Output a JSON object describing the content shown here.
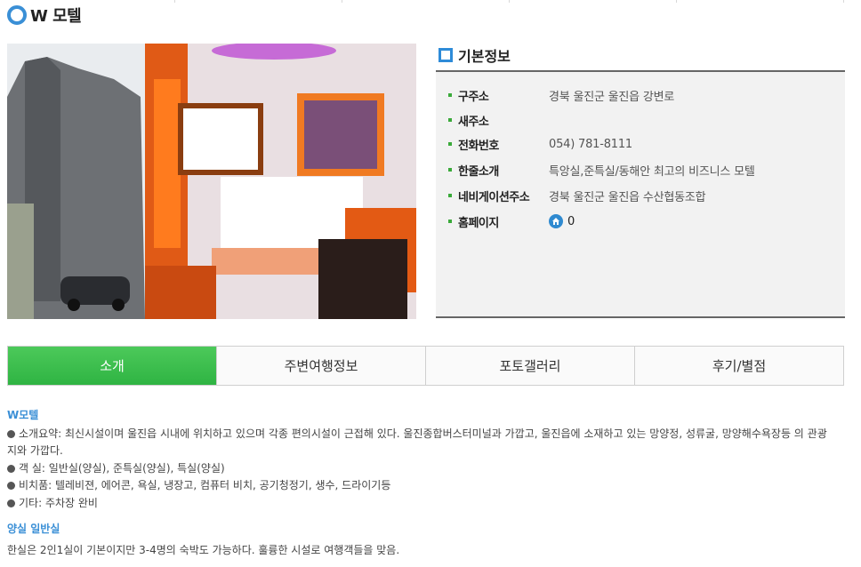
{
  "header": {
    "title": "W 모텔"
  },
  "info": {
    "heading": "기본정보",
    "rows": [
      {
        "label": "구주소",
        "value": "경북 울진군 울진읍 강변로"
      },
      {
        "label": "새주소",
        "value": ""
      },
      {
        "label": "전화번호",
        "value": "054) 781-8111"
      },
      {
        "label": "한줄소개",
        "value": "특앙실,준특실/동해안 최고의 비즈니스 모텔"
      },
      {
        "label": "네비게이션주소",
        "value": "경북 울진군 울진읍 수산협동조합"
      },
      {
        "label": "홈페이지",
        "value": "0"
      }
    ]
  },
  "tabs": [
    "소개",
    "주변여행정보",
    "포토갤러리",
    "후기/별점"
  ],
  "tabs_active": "소개",
  "content": {
    "section1_title": "W모텔",
    "section1_lines": [
      "소개요약: 최신시설이며 울진읍 시내에 위치하고 있으며 각종 편의시설이 근접해 있다. 울진종합버스터미널과 가깝고, 울진읍에 소재하고 있는 망양정, 성류굴, 망양해수욕장등 의 관광",
      "지와 가깝다.",
      "객 실: 일반실(양실), 준특실(양실), 특실(양실)",
      "비치품: 텔레비젼, 에어콘, 욕실, 냉장고, 컴퓨터 비치, 공기청정기, 생수, 드라이기등",
      "기타: 주차장 완비"
    ],
    "section2_title": "양실 일반실",
    "section2_text": "한실은 2인1실이 기본이지만 3-4명의 숙박도 가능하다. 훌륭한 시설로 여행객들을 맞음."
  },
  "colors": {
    "accent": "#3a8fd6",
    "tab_active": "#2fb443",
    "bullet": "#3aaa3a"
  }
}
